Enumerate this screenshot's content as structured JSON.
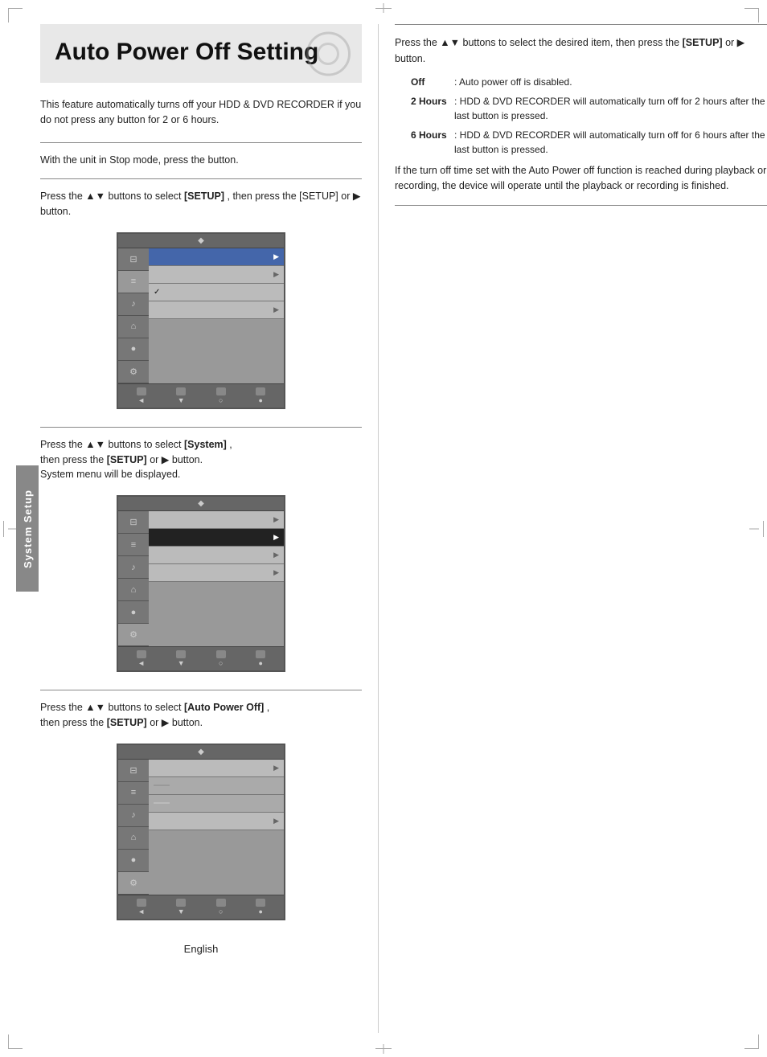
{
  "page": {
    "title": "Auto Power Off Setting",
    "language": "English",
    "side_label": "System Setup"
  },
  "intro": {
    "text": "This feature automatically turns off your HDD & DVD RECORDER if you do not press any button for 2 or 6 hours."
  },
  "steps": {
    "step1": {
      "text": "With the unit in Stop mode, press the button."
    },
    "step2": {
      "text1": "Press the ▲▼ buttons to select",
      "text2": ", then press the",
      "text3": "or ▶ button."
    },
    "step3": {
      "text1": "Press the ▲▼ buttons to select",
      "text2": ",",
      "text3": "then press the",
      "text4": "or ▶ button.",
      "text5": "System menu will be displayed."
    },
    "step4": {
      "text1": "Press the ▲▼ buttons to select",
      "text2": ",",
      "text3": "then press the",
      "text4": "or ▶ button."
    }
  },
  "right_col": {
    "step5": {
      "text1": "Press the ▲▼ buttons to select the desired item, then press the",
      "text2": "or ▶ button."
    },
    "options": {
      "off": {
        "label": "Off",
        "desc": ": Auto power off is disabled."
      },
      "2hr": {
        "label": "2 Hours",
        "desc": ": HDD & DVD RECORDER will automatically turn off for 2 hours after the last button is pressed."
      },
      "6hr": {
        "label": "6 Hours",
        "desc": ": HDD & DVD RECORDER will automatically turn off for 6 hours after the last button is pressed."
      }
    },
    "note": "If the turn off time set with the Auto Power off function is reached during playback or recording, the device will operate until the playback or recording is finished."
  },
  "menu": {
    "diamond": "◆",
    "arrow_right": "▶",
    "icons": [
      "⊟",
      "≡",
      "♪",
      "⌂",
      "●",
      "⚙"
    ],
    "footer_items": [
      "◄",
      "▼",
      "○",
      "●"
    ]
  }
}
